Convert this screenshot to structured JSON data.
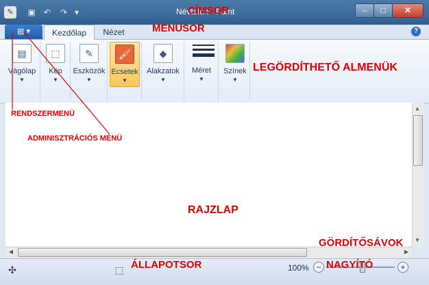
{
  "window": {
    "title": "Névtelen - Paint"
  },
  "app_menu": {
    "label": "▤ ▾"
  },
  "tabs": [
    {
      "label": "Kezdőlap"
    },
    {
      "label": "Nézet"
    }
  ],
  "help": {
    "label": "?"
  },
  "ribbon": {
    "clipboard": {
      "label": "Vágólap"
    },
    "image": {
      "label": "Kép"
    },
    "tools": {
      "label": "Eszközök"
    },
    "brushes": {
      "label": "Ecsetek"
    },
    "shapes": {
      "label": "Alakzatok"
    },
    "size": {
      "label": "Méret"
    },
    "colors": {
      "label": "Színek"
    }
  },
  "statusbar": {
    "zoom": "100%"
  },
  "annotations": {
    "title_bar": "CÍMSOR",
    "menu_bar": "MENÜSOR",
    "dropdown_menus": "LEGÖRDÍTHETŐ ALMENÜK",
    "system_menu": "RENDSZERMENÜ",
    "admin_menu": "ADMINISZTRÁCIÓS MENÜ",
    "canvas": "RAJZLAP",
    "scrollbars": "GÖRDÍTŐSÁVOK",
    "status_bar": "ÁLLAPOTSOR",
    "zoom": "NAGYÍTÓ"
  },
  "colors": {
    "annotation": "#e00000",
    "titlebar": "#3d6c9c",
    "app_button": "#2a6bc0"
  },
  "icons": [
    "paint-app-icon",
    "save-icon",
    "undo-icon",
    "redo-icon",
    "close-icon",
    "help-icon",
    "clipboard-icon",
    "image-icon",
    "tools-icon",
    "brushes-icon",
    "shapes-icon",
    "size-icon",
    "colors-icon",
    "move-cursor-icon",
    "selection-size-icon"
  ]
}
